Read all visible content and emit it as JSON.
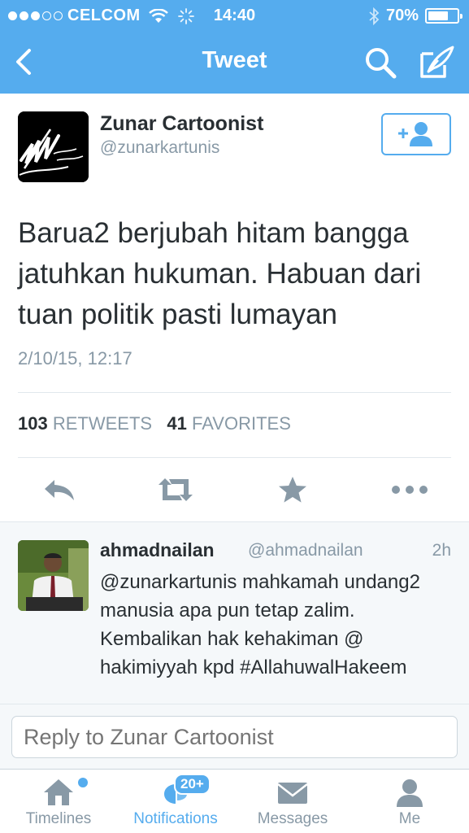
{
  "status_bar": {
    "carrier": "CELCOM",
    "time": "14:40",
    "battery": "70%",
    "battery_level": 0.7
  },
  "nav": {
    "title": "Tweet",
    "icons": [
      "back-chevron-icon",
      "search-icon",
      "compose-icon"
    ]
  },
  "tweet": {
    "author_name": "Zunar Cartoonist",
    "author_handle": "@zunarkartunis",
    "text": "Barua2 berjubah hitam bangga jatuhkan hukuman. Habuan dari tuan politik pasti lumayan",
    "timestamp": "2/10/15, 12:17",
    "retweets_count": "103",
    "retweets_label": "RETWEETS",
    "favorites_count": "41",
    "favorites_label": "FAVORITES"
  },
  "actions": [
    "reply-icon",
    "retweet-icon",
    "favorite-icon",
    "more-icon"
  ],
  "reply": {
    "name": "ahmadnailan",
    "handle": "@ahmadnailan",
    "time": "2h",
    "text": "@zunarkartunis mahkamah undang2 manusia apa pun tetap zalim. Kembalikan hak kehakiman @ hakimiyyah kpd #AllahuwalHakeem"
  },
  "reply_input": {
    "placeholder": "Reply to Zunar Cartoonist"
  },
  "tabs": [
    {
      "label": "Timelines",
      "icon": "home-icon"
    },
    {
      "label": "Notifications",
      "icon": "notifications-icon",
      "badge": "20+"
    },
    {
      "label": "Messages",
      "icon": "messages-icon"
    },
    {
      "label": "Me",
      "icon": "profile-icon"
    }
  ],
  "colors": {
    "accent": "#55acee",
    "text": "#292f33",
    "muted": "#8899a6"
  }
}
